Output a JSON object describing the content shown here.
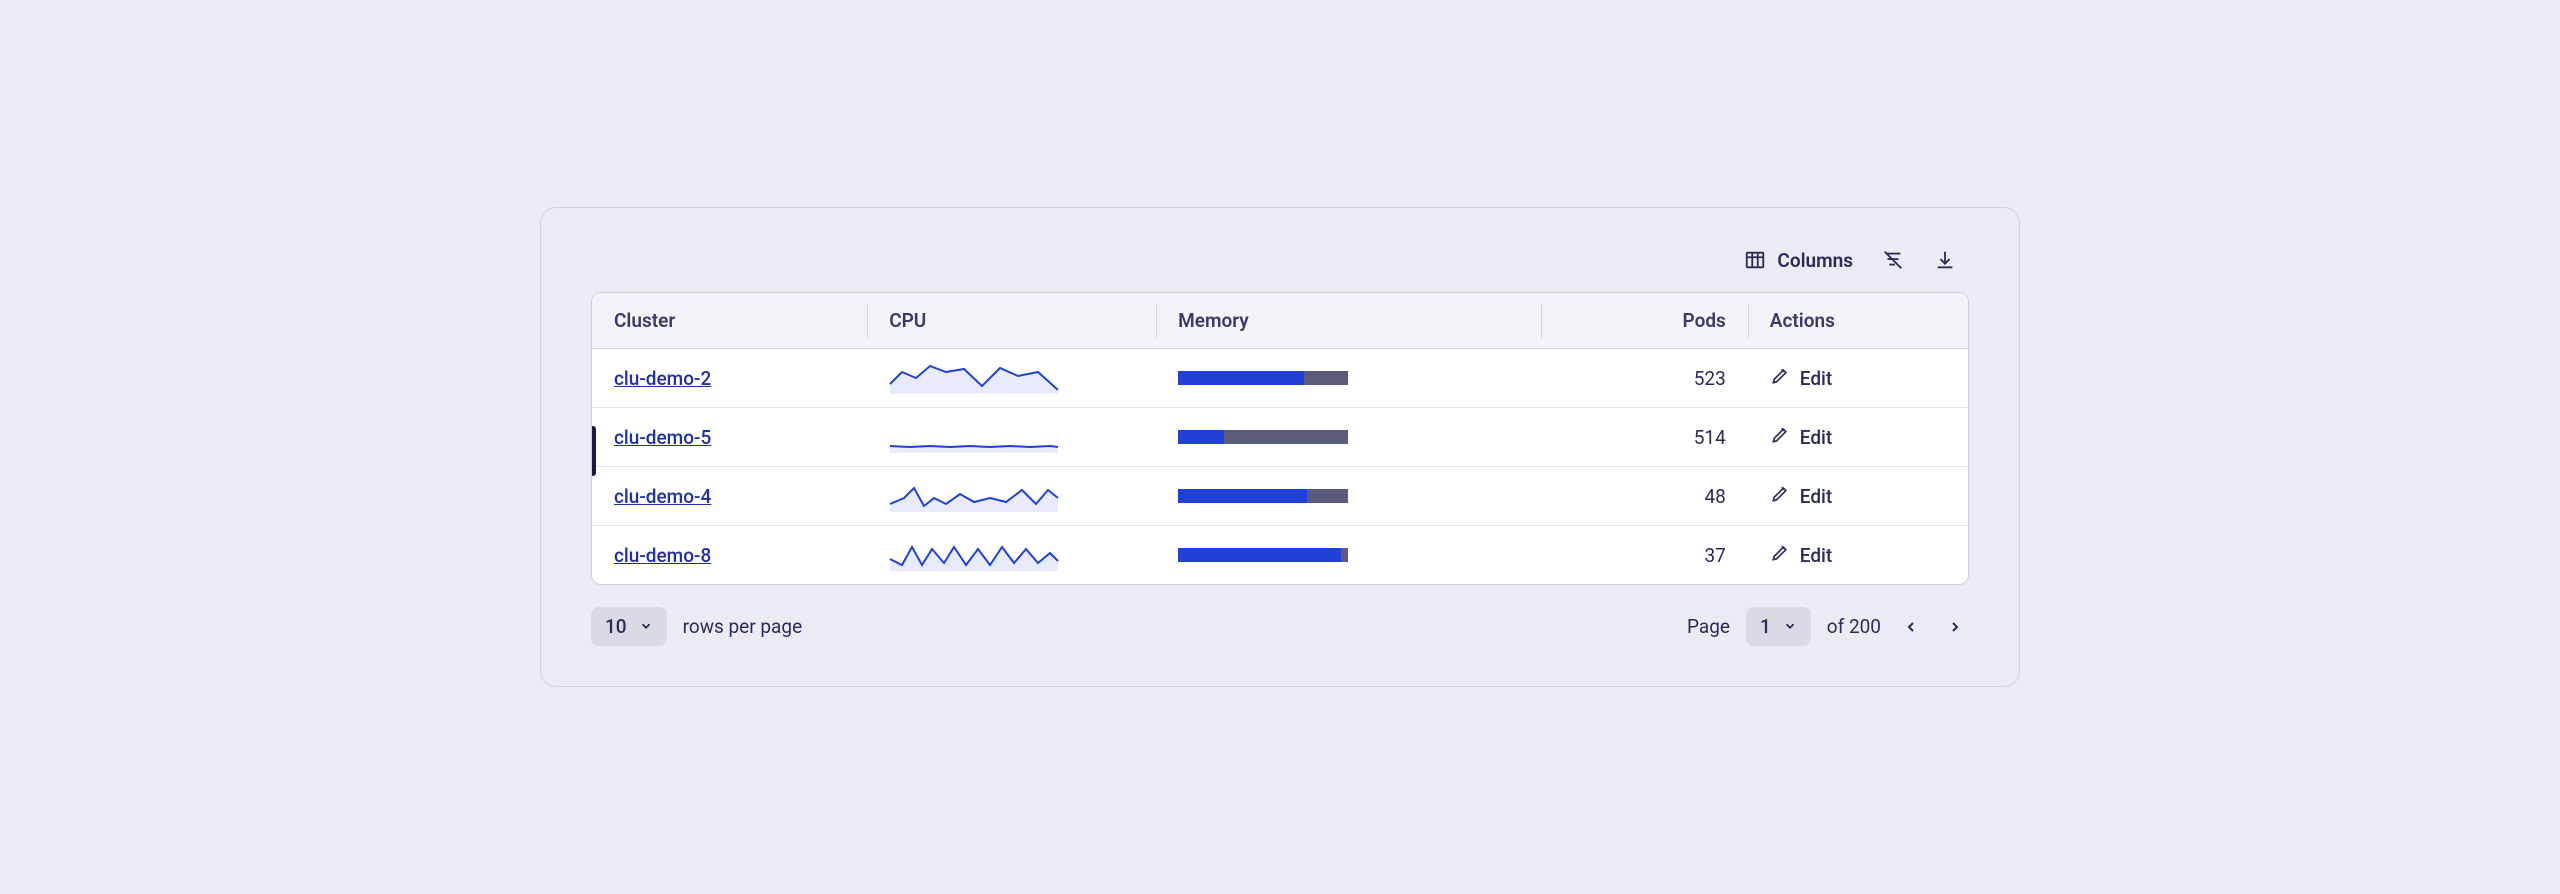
{
  "toolbar": {
    "columns_label": "Columns"
  },
  "headers": {
    "cluster": "Cluster",
    "cpu": "CPU",
    "memory": "Memory",
    "pods": "Pods",
    "actions": "Actions"
  },
  "rows": [
    {
      "cluster": "clu-demo-2",
      "pods": "523",
      "memory_pct": 74,
      "selected": false,
      "spark": "0,22 12,10 26,16 40,4 56,10 74,7 92,24 110,6 128,14 148,10 168,28"
    },
    {
      "cluster": "clu-demo-5",
      "pods": "514",
      "memory_pct": 27,
      "selected": true,
      "spark": "0,25 20,26 40,25 60,26 80,25 100,26 120,25 140,26 160,25 168,26"
    },
    {
      "cluster": "clu-demo-4",
      "pods": "48",
      "memory_pct": 76,
      "selected": false,
      "spark": "0,24 14,18 24,8 34,26 44,18 56,24 70,14 84,22 100,18 116,22 132,10 146,24 158,10 168,18"
    },
    {
      "cluster": "clu-demo-8",
      "pods": "37",
      "memory_pct": 96,
      "selected": false,
      "spark": "0,20 12,26 22,8 32,26 42,10 54,24 64,8 76,26 88,10 100,26 112,8 124,24 136,10 148,24 160,14 168,22"
    }
  ],
  "actions": {
    "edit_label": "Edit"
  },
  "pager": {
    "rows_per_page_value": "10",
    "rows_per_page_label": "rows per page",
    "page_label": "Page",
    "current_page": "1",
    "total_label": "of 200"
  }
}
